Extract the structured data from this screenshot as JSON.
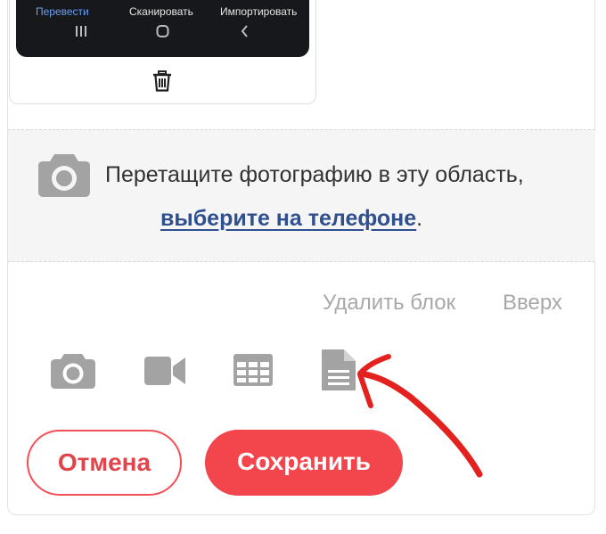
{
  "phone_preview": {
    "tabs": [
      {
        "label": "Перевести",
        "active": true
      },
      {
        "label": "Сканировать",
        "active": false
      },
      {
        "label": "Импортировать",
        "active": false
      }
    ],
    "nav_icons": [
      "recent-apps-icon",
      "home-icon",
      "back-icon"
    ]
  },
  "dropzone": {
    "text": "Перетащите фотографию в эту область,",
    "link": "выберите на телефоне",
    "suffix": "."
  },
  "block_actions": {
    "delete": "Удалить блок",
    "up": "Вверх"
  },
  "toolbar": {
    "icons": [
      "camera-icon",
      "video-icon",
      "table-icon",
      "document-icon"
    ]
  },
  "buttons": {
    "cancel": "Отмена",
    "save": "Сохранить"
  },
  "colors": {
    "accent": "#f2454c",
    "link": "#2f4f8f",
    "icon_gray": "#a3a3a3",
    "annotation_arrow": "#e3221f"
  }
}
